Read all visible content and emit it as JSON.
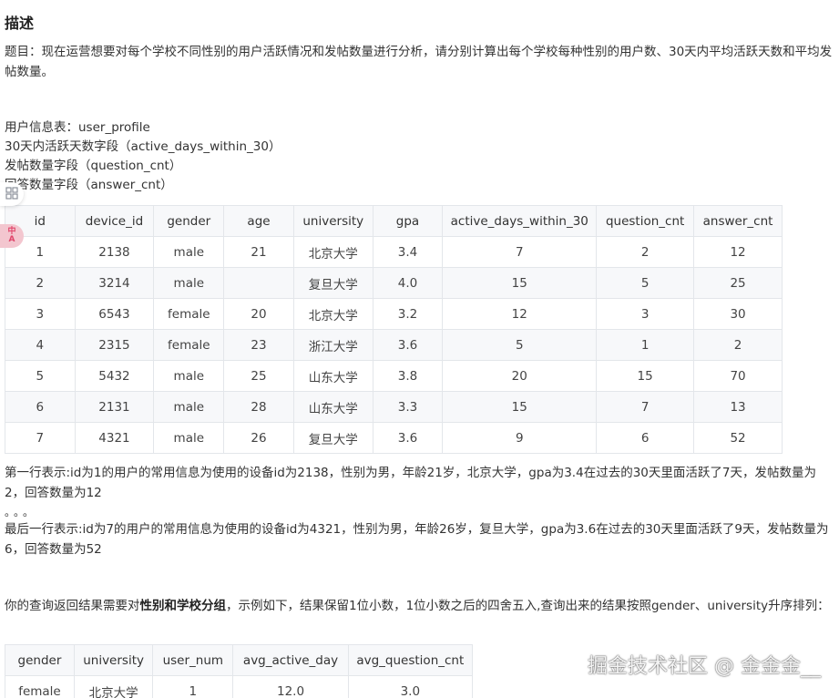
{
  "heading": "描述",
  "description": "题目：现在运营想要对每个学校不同性别的用户活跃情况和发帖数量进行分析，请分别计算出每个学校每种性别的用户数、30天内平均活跃天数和平均发帖数量。",
  "fields": [
    "用户信息表：user_profile",
    "30天内活跃天数字段（active_days_within_30）",
    "发帖数量字段（question_cnt）",
    "回答数量字段（answer_cnt）"
  ],
  "table1": {
    "headers": [
      "id",
      "device_id",
      "gender",
      "age",
      "university",
      "gpa",
      "active_days_within_30",
      "question_cnt",
      "answer_cnt"
    ],
    "rows": [
      [
        "1",
        "2138",
        "male",
        "21",
        "北京大学",
        "3.4",
        "7",
        "2",
        "12"
      ],
      [
        "2",
        "3214",
        "male",
        "",
        "复旦大学",
        "4.0",
        "15",
        "5",
        "25"
      ],
      [
        "3",
        "6543",
        "female",
        "20",
        "北京大学",
        "3.2",
        "12",
        "3",
        "30"
      ],
      [
        "4",
        "2315",
        "female",
        "23",
        "浙江大学",
        "3.6",
        "5",
        "1",
        "2"
      ],
      [
        "5",
        "5432",
        "male",
        "25",
        "山东大学",
        "3.8",
        "20",
        "15",
        "70"
      ],
      [
        "6",
        "2131",
        "male",
        "28",
        "山东大学",
        "3.3",
        "15",
        "7",
        "13"
      ],
      [
        "7",
        "4321",
        "male",
        "26",
        "复旦大学",
        "3.6",
        "9",
        "6",
        "52"
      ]
    ]
  },
  "note_first": "第一行表示:id为1的用户的常用信息为使用的设备id为2138，性别为男，年龄21岁，北京大学，gpa为3.4在过去的30天里面活跃了7天，发帖数量为2，回答数量为12",
  "dots": "。。。",
  "note_last": "最后一行表示:id为7的用户的常用信息为使用的设备id为4321，性别为男，年龄26岁，复旦大学，gpa为3.6在过去的30天里面活跃了9天，发帖数量为6，回答数量为52",
  "requirement": {
    "prefix": "你的查询返回结果需要对",
    "bold": "性别和学校分组",
    "suffix": "，示例如下，结果保留1位小数，1位小数之后的四舍五入,查询出来的结果按照gender、university升序排列："
  },
  "table2": {
    "headers": [
      "gender",
      "university",
      "user_num",
      "avg_active_day",
      "avg_question_cnt"
    ],
    "rows": [
      [
        "female",
        "北京大学",
        "1",
        "12.0",
        "3.0"
      ]
    ]
  },
  "float_buttons": {
    "grid_icon": "apps-grid-icon",
    "translate_label_top": "中",
    "translate_label_bottom": "A"
  },
  "watermark": "掘金技术社区 @ 金金金__"
}
